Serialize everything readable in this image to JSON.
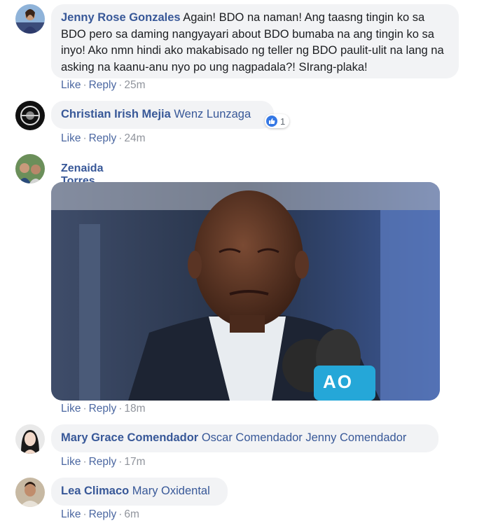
{
  "comments": [
    {
      "author": "Jenny Rose Gonzales",
      "text": " Again! BDO na naman! Ang taasng tingin ko sa BDO pero sa daming nangyayari about BDO bumaba na ang tingin ko sa inyo! Ako nmn hindi ako makabisado ng teller ng BDO paulit-ulit na lang na asking na kaanu-anu nyo po ung nagpadala?! SIrang-plaka!",
      "like": "Like",
      "reply": "Reply",
      "time": "25m"
    },
    {
      "author": "Christian Irish Mejia",
      "tag": " Wenz Lunzaga",
      "like": "Like",
      "reply": "Reply",
      "time": "24m",
      "reaction_count": "1"
    },
    {
      "author": "Zenaida Torres",
      "like": "Like",
      "reply": "Reply",
      "time": "18m"
    },
    {
      "author": "Mary Grace Comendador",
      "tag": " Oscar Comendador Jenny Comendador",
      "like": "Like",
      "reply": "Reply",
      "time": "17m"
    },
    {
      "author": "Lea Climaco",
      "tag": " Mary Oxidental",
      "like": "Like",
      "reply": "Reply",
      "time": "6m"
    }
  ],
  "photo": {
    "mic_logo": "AO"
  },
  "colors": {
    "link": "#385898",
    "bubble": "#f2f3f5",
    "meta": "#90949c"
  }
}
